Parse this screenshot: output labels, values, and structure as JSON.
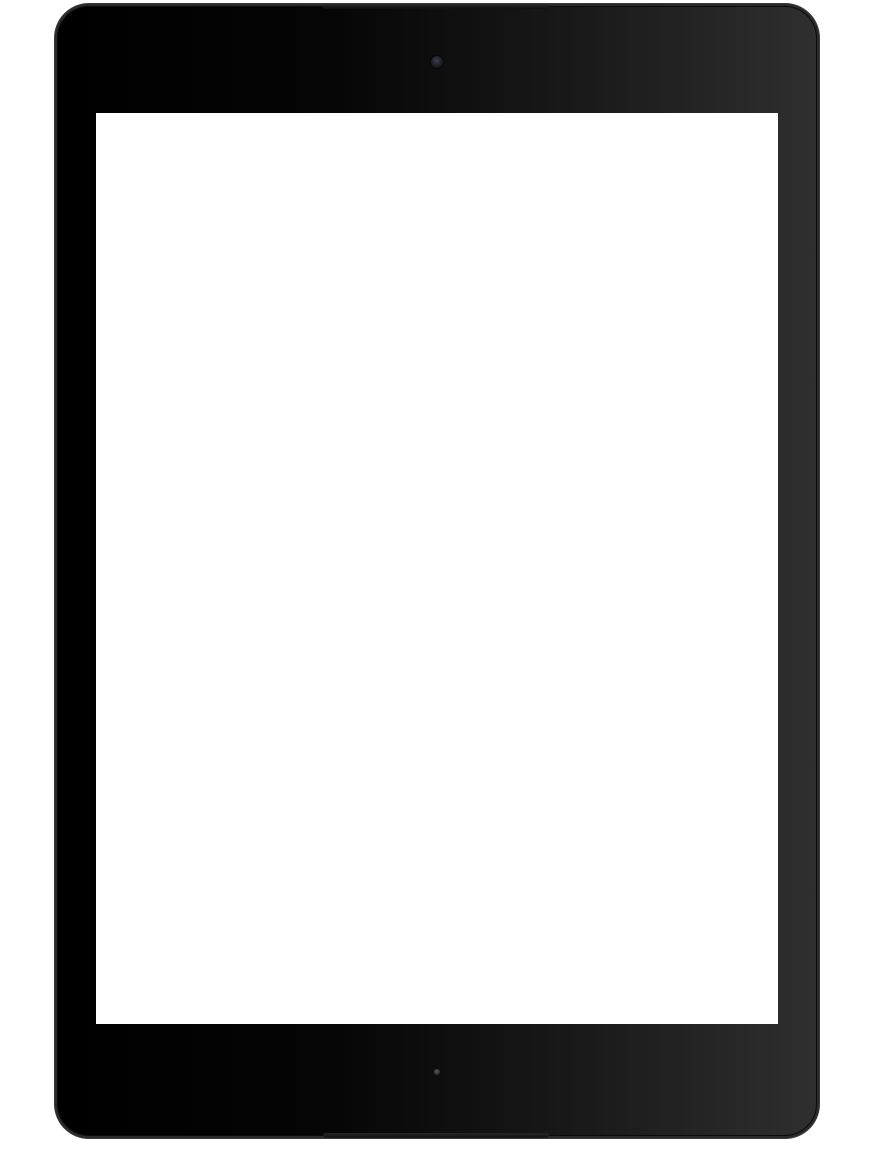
{
  "device": {
    "type": "tablet",
    "frame_color": "#000000",
    "screen_color": "#ffffff"
  },
  "icons": {
    "front_camera": "camera-icon",
    "bottom_sensor": "sensor-icon"
  }
}
